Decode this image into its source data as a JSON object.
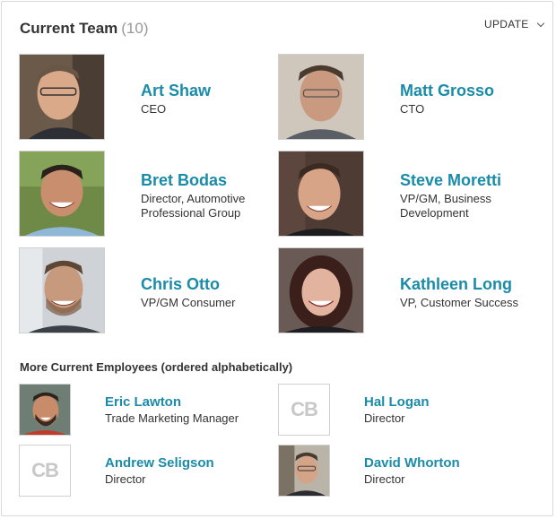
{
  "header": {
    "title": "Current Team",
    "count": "(10)",
    "update_label": "UPDATE"
  },
  "team": [
    {
      "name": "Art Shaw",
      "role": "CEO"
    },
    {
      "name": "Matt Grosso",
      "role": "CTO"
    },
    {
      "name": "Bret Bodas",
      "role": "Director, Automotive Professional Group"
    },
    {
      "name": "Steve Moretti",
      "role": "VP/GM, Business Development"
    },
    {
      "name": "Chris Otto",
      "role": "VP/GM Consumer"
    },
    {
      "name": "Kathleen Long",
      "role": "VP, Customer Success"
    }
  ],
  "more": {
    "heading": "More Current Employees (ordered alphabetically)",
    "placeholder_initials": "CB",
    "employees": [
      {
        "name": "Eric Lawton",
        "role": "Trade Marketing Manager"
      },
      {
        "name": "Hal Logan",
        "role": "Director"
      },
      {
        "name": "Andrew Seligson",
        "role": "Director"
      },
      {
        "name": "David Whorton",
        "role": "Director"
      }
    ]
  },
  "colors": {
    "link": "#1a8ba8",
    "text": "#333333",
    "muted": "#999999"
  }
}
